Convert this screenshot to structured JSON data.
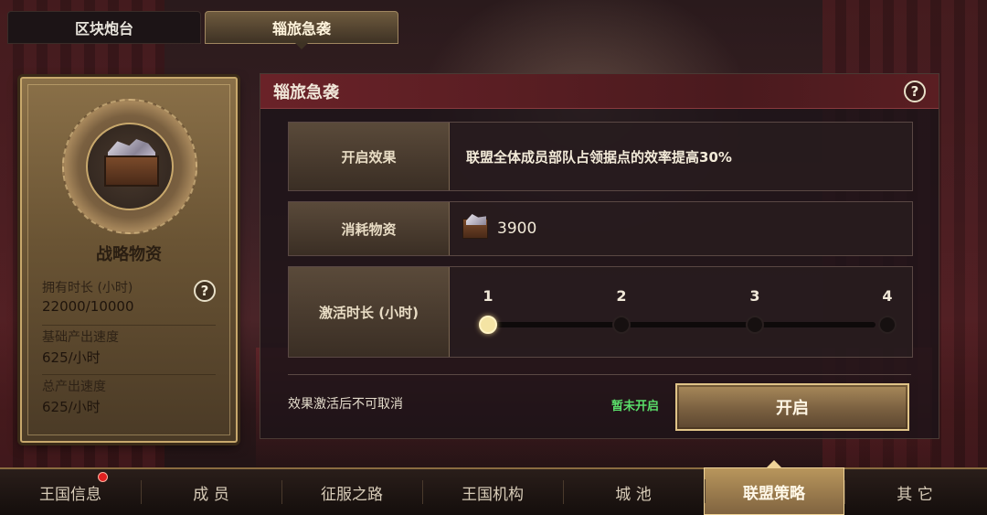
{
  "top_tabs": [
    {
      "label": "区块炮台",
      "active": false
    },
    {
      "label": "辎旅急袭",
      "active": true
    }
  ],
  "info_card": {
    "item_icon": "resource-crate-icon",
    "title": "战略物资",
    "stats": [
      {
        "label": "拥有时长 (小时)",
        "value": "22000/10000",
        "has_help": true
      },
      {
        "label": "基础产出速度",
        "value": "625/小时"
      },
      {
        "label": "总产出速度",
        "value": "625/小时"
      }
    ]
  },
  "panel": {
    "title": "辎旅急袭",
    "help_icon": "question-icon",
    "effect": {
      "label": "开启效果",
      "value": "联盟全体成员部队占领据点的效率提高30%"
    },
    "cost": {
      "label": "消耗物资",
      "icon": "resource-crate-icon",
      "amount": "3900"
    },
    "duration": {
      "label": "激活时长 (小时)",
      "options": [
        "1",
        "2",
        "3",
        "4"
      ],
      "selected_index": 0
    },
    "warning": "效果激活后不可取消",
    "status": "暂未开启",
    "status_color": "#5ade6a",
    "open_button": "开启"
  },
  "bottom_nav": [
    {
      "label": "王国信息",
      "badge": true
    },
    {
      "label": "成 员"
    },
    {
      "label": "征服之路"
    },
    {
      "label": "王国机构"
    },
    {
      "label": "城 池"
    },
    {
      "label": "联盟策略",
      "active": true
    },
    {
      "label": "其 它"
    }
  ],
  "colors": {
    "accent_gold": "#c8a86c",
    "header_red": "#6a2228",
    "active_slider": "#f4e4a4"
  }
}
